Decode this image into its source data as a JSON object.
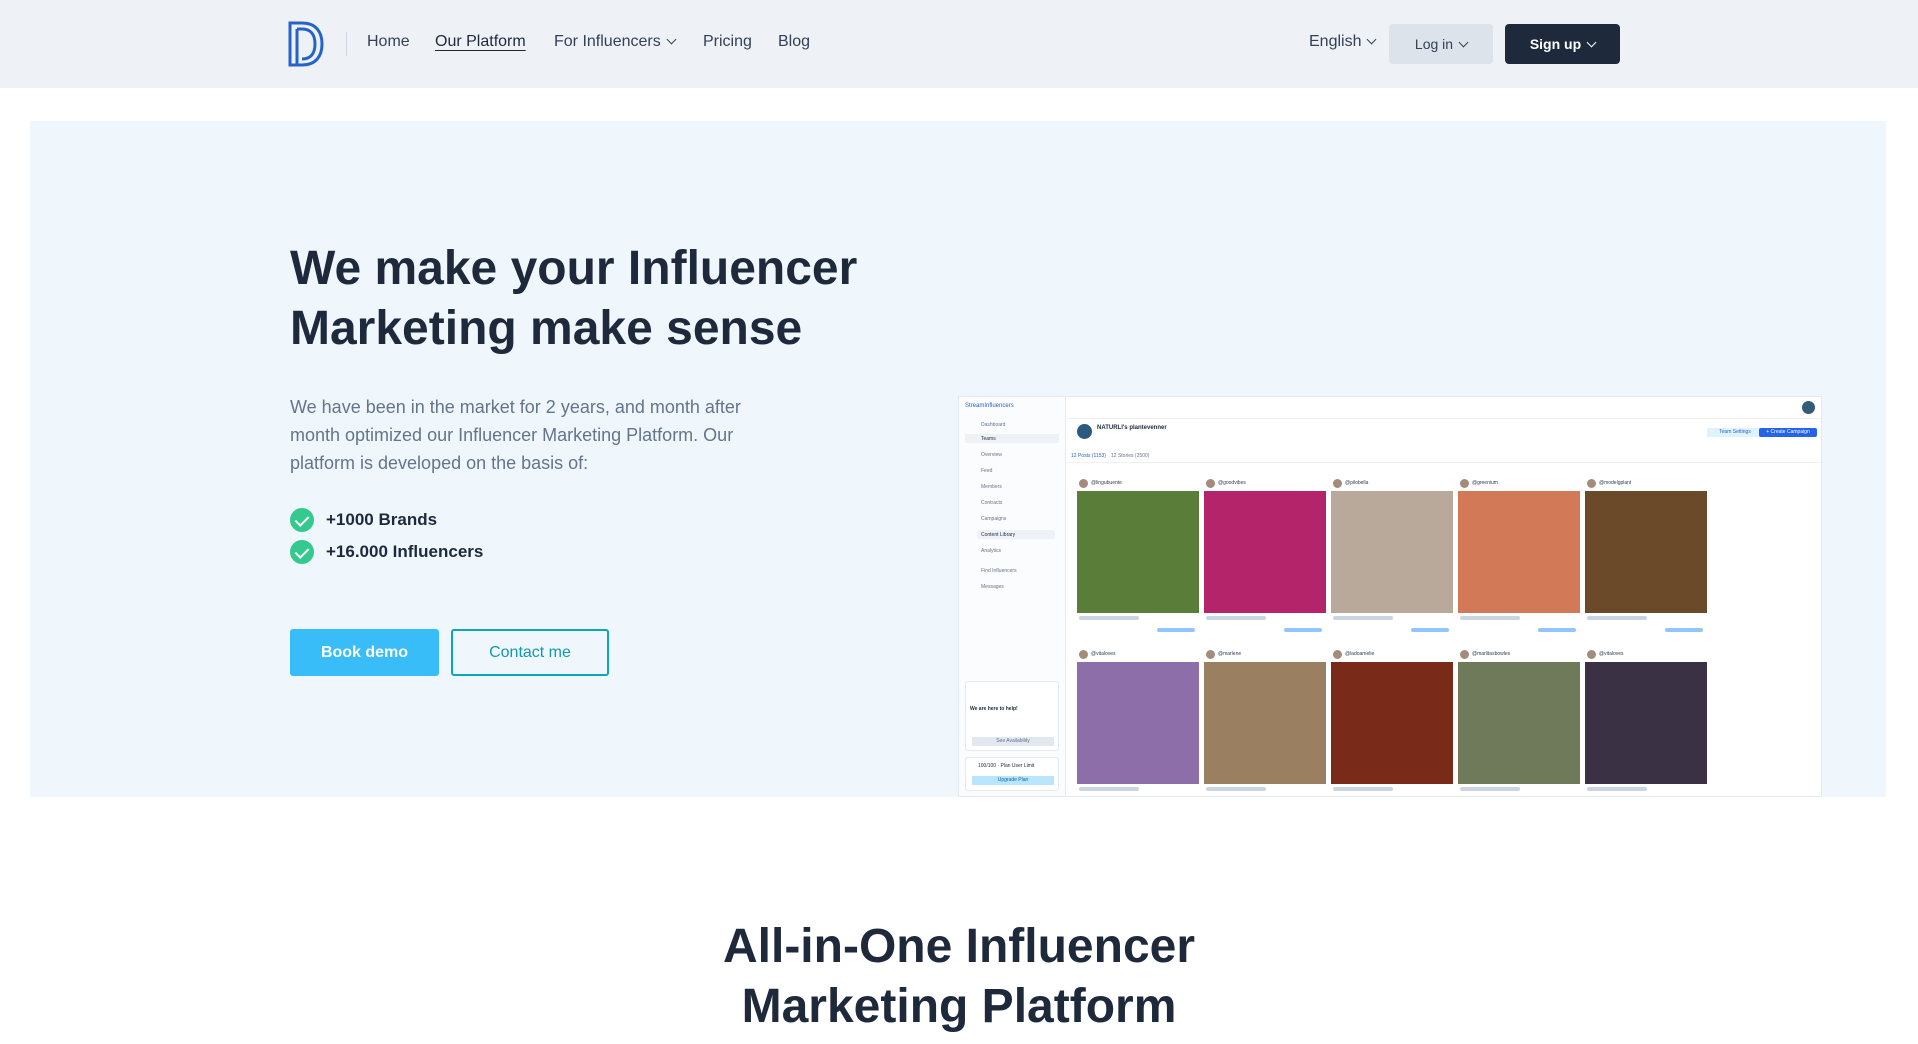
{
  "nav": {
    "links": [
      "Home",
      "Our Platform",
      "For Influencers",
      "Pricing",
      "Blog"
    ],
    "language": "English",
    "login": "Log in",
    "signup": "Sign up"
  },
  "hero": {
    "title": "We make your Influencer Marketing make sense",
    "lead": "We have been in the market for 2 years, and month after month optimized our Influencer Marketing Platform. Our platform is developed on the basis of:",
    "features": [
      "+1000 Brands",
      "+16.000 Influencers"
    ],
    "book_demo": "Book demo",
    "contact": "Contact me"
  },
  "mockup": {
    "brand": "StreamInfluencers",
    "page_title": "NATURLI's plantevenner",
    "sidebar": [
      "Dashboard",
      "Teams",
      "Overview",
      "Feed",
      "Members",
      "Contracts",
      "Campaigns",
      "Content Library",
      "Analytics",
      "Find Influencers",
      "Messages"
    ],
    "help_title": "We are here to help!",
    "help_button": "See Availability",
    "plan_limit": "100/100 · Plan User Limit",
    "upgrade": "Upgrade Plan",
    "tabs": [
      "12 Posts (1153)",
      "12 Stories (2500)"
    ],
    "create_campaign": "+ Create Campaign",
    "team_settings": "Team Settings",
    "view_link": "View on Instagram",
    "cards": [
      {
        "handle": "@lingubuente",
        "color": "#5a7d3a"
      },
      {
        "handle": "@goodvibes",
        "color": "#b4246a"
      },
      {
        "handle": "@pilobella",
        "color": "#b9a99a"
      },
      {
        "handle": "@greenium",
        "color": "#d27a57"
      },
      {
        "handle": "@modelgplant",
        "color": "#6b4a2a"
      },
      {
        "handle": "@vitaloves",
        "color": "#8d6ea8"
      },
      {
        "handle": "@marlene",
        "color": "#9a8060"
      },
      {
        "handle": "@ladoamelie",
        "color": "#7a2a18"
      },
      {
        "handle": "@marlitasbowles",
        "color": "#6e7a5a"
      },
      {
        "handle": "@vitaloves",
        "color": "#3b3145"
      }
    ]
  },
  "section": {
    "title": "All-in-One Influencer Marketing Platform"
  }
}
